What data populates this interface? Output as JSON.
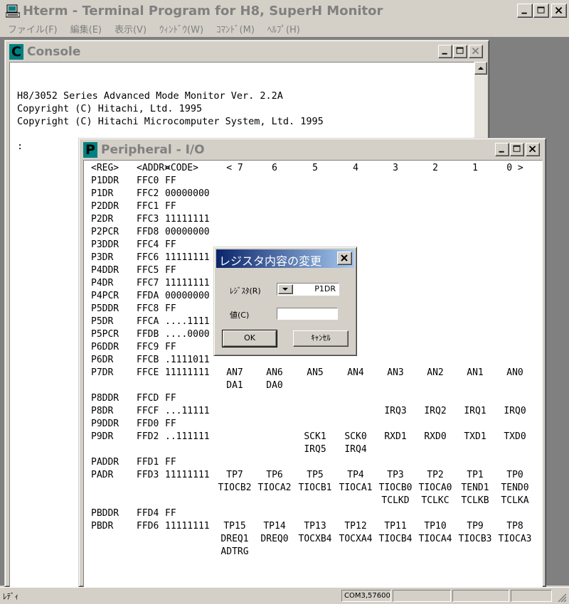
{
  "main_window": {
    "title": "Hterm - Terminal Program for H8, SuperH Monitor",
    "icon": "hterm-app-icon"
  },
  "menu": [
    "ファイル(F)",
    "編集(E)",
    "表示(V)",
    "ｳｨﾝﾄﾞｳ(W)",
    "ｺﾏﾝﾄﾞ(M)",
    "ﾍﾙﾌﾟ(H)"
  ],
  "console": {
    "icon_letter": "C",
    "title": "Console",
    "lines": [
      "H8/3052 Series Advanced Mode Monitor Ver. 2.2A",
      "Copyright (C) Hitachi, Ltd. 1995",
      "Copyright (C) Hitachi Microcomputer System, Ltd. 1995"
    ],
    "prompt": ":"
  },
  "peripheral": {
    "icon_letter": "P",
    "title": "Peripheral - I/O",
    "header": {
      "reg": "<REG>",
      "addr": "<ADDR>",
      "code": "<CODE>",
      "bits": [
        "< 7",
        "6",
        "5",
        "4",
        "3",
        "2",
        "1",
        "0 >"
      ]
    },
    "rows": [
      {
        "reg": "P1DDR",
        "addr": "FFC0",
        "code": "FF",
        "bits": [
          [],
          [],
          [],
          [],
          [],
          [],
          [],
          []
        ]
      },
      {
        "reg": "P1DR",
        "addr": "FFC2",
        "code": "00000000",
        "bits": [
          [],
          [],
          [],
          [],
          [],
          [],
          [],
          []
        ]
      },
      {
        "reg": "P2DDR",
        "addr": "FFC1",
        "code": "FF",
        "bits": [
          [],
          [],
          [],
          [],
          [],
          [],
          [],
          []
        ]
      },
      {
        "reg": "P2DR",
        "addr": "FFC3",
        "code": "11111111",
        "bits": [
          [],
          [],
          [],
          [],
          [],
          [],
          [],
          []
        ]
      },
      {
        "reg": "P2PCR",
        "addr": "FFD8",
        "code": "00000000",
        "bits": [
          [],
          [],
          [],
          [],
          [],
          [],
          [],
          []
        ]
      },
      {
        "reg": "P3DDR",
        "addr": "FFC4",
        "code": "FF",
        "bits": [
          [],
          [],
          [],
          [],
          [],
          [],
          [],
          []
        ]
      },
      {
        "reg": "P3DR",
        "addr": "FFC6",
        "code": "11111111",
        "bits": [
          [],
          [],
          [],
          [],
          [],
          [],
          [],
          []
        ]
      },
      {
        "reg": "P4DDR",
        "addr": "FFC5",
        "code": "FF",
        "bits": [
          [],
          [],
          [],
          [],
          [],
          [],
          [],
          []
        ]
      },
      {
        "reg": "P4DR",
        "addr": "FFC7",
        "code": "11111111",
        "bits": [
          [],
          [],
          [],
          [],
          [],
          [],
          [],
          []
        ]
      },
      {
        "reg": "P4PCR",
        "addr": "FFDA",
        "code": "00000000",
        "bits": [
          [],
          [],
          [],
          [],
          [],
          [],
          [],
          []
        ]
      },
      {
        "reg": "P5DDR",
        "addr": "FFC8",
        "code": "FF",
        "bits": [
          [],
          [],
          [],
          [],
          [],
          [],
          [],
          []
        ]
      },
      {
        "reg": "P5DR",
        "addr": "FFCA",
        "code": "....1111",
        "bits": [
          [],
          [],
          [],
          [],
          [],
          [],
          [],
          []
        ]
      },
      {
        "reg": "P5PCR",
        "addr": "FFDB",
        "code": "....0000",
        "bits": [
          [],
          [],
          [],
          [],
          [],
          [],
          [],
          []
        ]
      },
      {
        "reg": "P6DDR",
        "addr": "FFC9",
        "code": "FF",
        "bits": [
          [],
          [],
          [],
          [],
          [],
          [],
          [],
          []
        ]
      },
      {
        "reg": "P6DR",
        "addr": "FFCB",
        "code": ".1111011",
        "bits": [
          [],
          [],
          [],
          [],
          [],
          [],
          [],
          []
        ]
      },
      {
        "reg": "P7DR",
        "addr": "FFCE",
        "code": "11111111",
        "bits": [
          [
            "AN7",
            "DA1"
          ],
          [
            "AN6",
            "DA0"
          ],
          [
            "AN5"
          ],
          [
            "AN4"
          ],
          [
            "AN3"
          ],
          [
            "AN2"
          ],
          [
            "AN1"
          ],
          [
            "AN0"
          ]
        ]
      },
      {
        "reg": "P8DDR",
        "addr": "FFCD",
        "code": "FF",
        "bits": [
          [],
          [],
          [],
          [],
          [],
          [],
          [],
          []
        ]
      },
      {
        "reg": "P8DR",
        "addr": "FFCF",
        "code": "...11111",
        "bits": [
          [],
          [],
          [],
          [],
          [
            "IRQ3"
          ],
          [
            "IRQ2"
          ],
          [
            "IRQ1"
          ],
          [
            "IRQ0"
          ]
        ]
      },
      {
        "reg": "P9DDR",
        "addr": "FFD0",
        "code": "FF",
        "bits": [
          [],
          [],
          [],
          [],
          [],
          [],
          [],
          []
        ]
      },
      {
        "reg": "P9DR",
        "addr": "FFD2",
        "code": "..111111",
        "bits": [
          [],
          [],
          [
            "SCK1",
            "IRQ5"
          ],
          [
            "SCK0",
            "IRQ4"
          ],
          [
            "RXD1"
          ],
          [
            "RXD0"
          ],
          [
            "TXD1"
          ],
          [
            "TXD0"
          ]
        ]
      },
      {
        "reg": "PADDR",
        "addr": "FFD1",
        "code": "FF",
        "bits": [
          [],
          [],
          [],
          [],
          [],
          [],
          [],
          []
        ]
      },
      {
        "reg": "PADR",
        "addr": "FFD3",
        "code": "11111111",
        "bits": [
          [
            "TP7",
            "TIOCB2"
          ],
          [
            "TP6",
            "TIOCA2"
          ],
          [
            "TP5",
            "TIOCB1"
          ],
          [
            "TP4",
            "TIOCA1"
          ],
          [
            "TP3",
            "TIOCB0",
            "TCLKD"
          ],
          [
            "TP2",
            "TIOCA0",
            "TCLKC"
          ],
          [
            "TP1",
            "TEND1",
            "TCLKB"
          ],
          [
            "TP0",
            "TEND0",
            "TCLKA"
          ]
        ]
      },
      {
        "reg": "PBDDR",
        "addr": "FFD4",
        "code": "FF",
        "bits": [
          [],
          [],
          [],
          [],
          [],
          [],
          [],
          []
        ]
      },
      {
        "reg": "PBDR",
        "addr": "FFD6",
        "code": "11111111",
        "bits": [
          [
            "TP15",
            "DREQ1",
            "ADTRG"
          ],
          [
            "TP14",
            "DREQ0"
          ],
          [
            "TP13",
            "TOCXB4"
          ],
          [
            "TP12",
            "TOCXA4"
          ],
          [
            "TP11",
            "TIOCB4"
          ],
          [
            "TP10",
            "TIOCA4"
          ],
          [
            "TP9",
            "TIOCB3"
          ],
          [
            "TP8",
            "TIOCA3"
          ]
        ]
      }
    ]
  },
  "dialog": {
    "title": "レジスタ内容の変更",
    "register_label": "ﾚｼﾞｽﾀ(R)",
    "register_value": "P1DR",
    "value_label": "値(C)",
    "value_text": "",
    "ok_label": "OK",
    "cancel_label": "ｷｬﾝｾﾙ"
  },
  "statusbar": {
    "text": "ﾚﾃﾞｨ",
    "port": "COM3,57600"
  },
  "colors": {
    "face": "#d4d0c8",
    "mdi_background": "#808080",
    "inactive_title_text": "#808080",
    "dialog_title_start": "#0a246a",
    "dialog_title_end": "#a6caf0",
    "child_icon": "#008080"
  }
}
